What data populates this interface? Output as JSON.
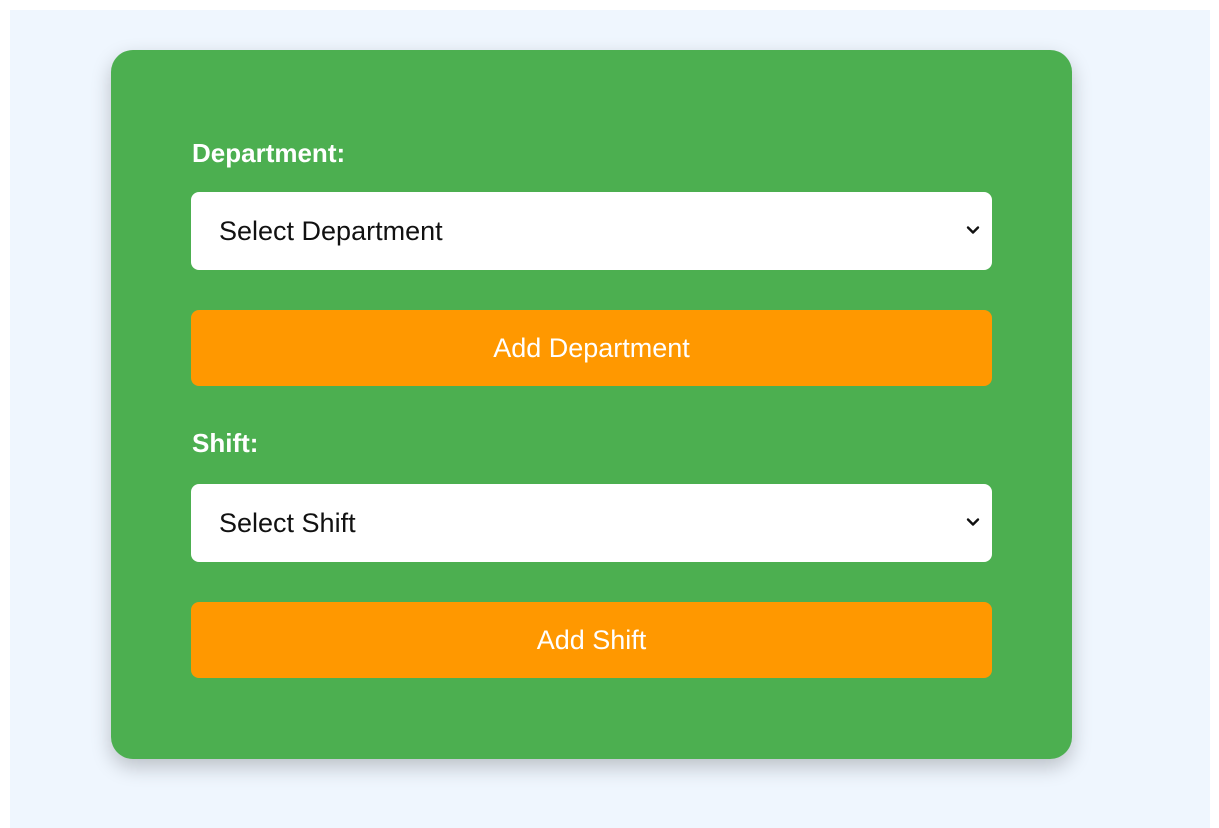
{
  "form": {
    "department_label": "Department:",
    "department_select": {
      "selected": "Select Department",
      "icon": "chevron-down-icon"
    },
    "add_department_label": "Add Department",
    "shift_label": "Shift:",
    "shift_select": {
      "selected": "Select Shift",
      "icon": "chevron-down-icon"
    },
    "add_shift_label": "Add Shift"
  },
  "colors": {
    "page_background": "#eff6fe",
    "card_background": "#4caf50",
    "button_background": "#ff9800",
    "select_background": "#ffffff",
    "label_text": "#ffffff"
  }
}
